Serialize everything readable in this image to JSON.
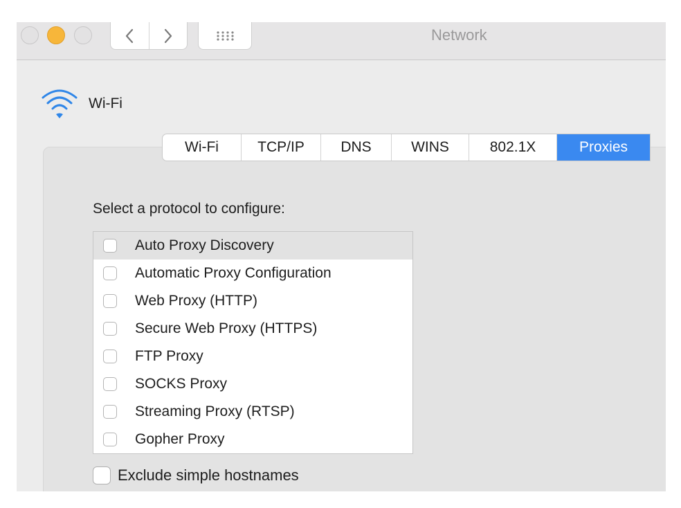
{
  "window": {
    "title": "Network"
  },
  "service": {
    "name": "Wi-Fi",
    "icon": "wifi-icon"
  },
  "tabs": [
    {
      "label": "Wi-Fi",
      "active": false
    },
    {
      "label": "TCP/IP",
      "active": false
    },
    {
      "label": "DNS",
      "active": false
    },
    {
      "label": "WINS",
      "active": false
    },
    {
      "label": "802.1X",
      "active": false
    },
    {
      "label": "Proxies",
      "active": true
    }
  ],
  "proxies": {
    "prompt": "Select a protocol to configure:",
    "protocols": [
      {
        "label": "Auto Proxy Discovery",
        "checked": false,
        "selected": true
      },
      {
        "label": "Automatic Proxy Configuration",
        "checked": false,
        "selected": false
      },
      {
        "label": "Web Proxy (HTTP)",
        "checked": false,
        "selected": false
      },
      {
        "label": "Secure Web Proxy (HTTPS)",
        "checked": false,
        "selected": false
      },
      {
        "label": "FTP Proxy",
        "checked": false,
        "selected": false
      },
      {
        "label": "SOCKS Proxy",
        "checked": false,
        "selected": false
      },
      {
        "label": "Streaming Proxy (RTSP)",
        "checked": false,
        "selected": false
      },
      {
        "label": "Gopher Proxy",
        "checked": false,
        "selected": false
      }
    ],
    "exclude_simple_hostnames": {
      "label": "Exclude simple hostnames",
      "checked": false
    }
  },
  "colors": {
    "accent": "#3a89f0",
    "wifi": "#2f86e8",
    "minimize": "#f7b63a"
  }
}
